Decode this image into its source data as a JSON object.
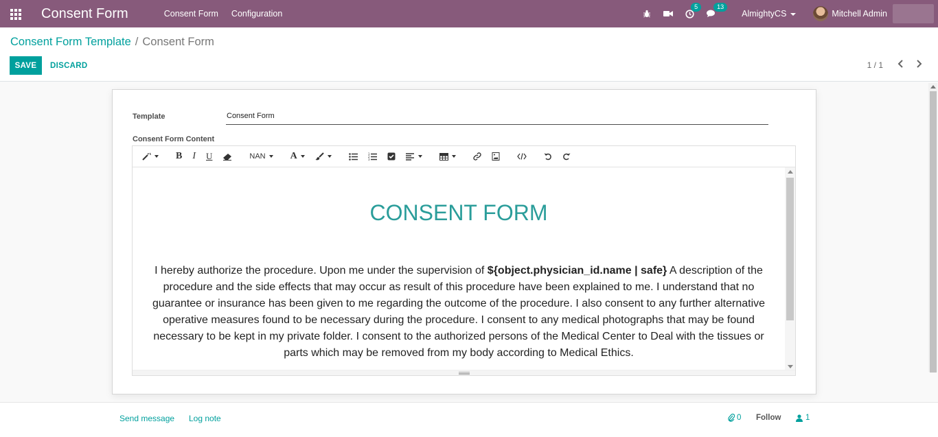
{
  "navbar": {
    "brand": "Consent Form",
    "menu": [
      "Consent Form",
      "Configuration"
    ],
    "activity_count": "5",
    "message_count": "13",
    "company": "AlmightyCS",
    "user_name": "Mitchell Admin",
    "color": "#875a7b"
  },
  "control_panel": {
    "breadcrumb_parent": "Consent Form Template",
    "breadcrumb_sep": "/",
    "breadcrumb_current": "Consent Form",
    "save_label": "SAVE",
    "discard_label": "DISCARD",
    "pager": "1 / 1"
  },
  "form": {
    "template_label": "Template",
    "template_value": "Consent Form",
    "content_label": "Consent Form Content",
    "toolbar": {
      "bold": "B",
      "italic": "I",
      "underline": "U",
      "font_size": "NAN",
      "font_color": "A"
    },
    "content": {
      "title": "CONSENT FORM",
      "text_before": "I hereby authorize the procedure. Upon me under the supervision of ",
      "placeholder": "${object.physician_id.name | safe}",
      "text_after": " A description of the procedure and the side effects that may occur as result of this procedure have been explained to me. I understand that no guarantee or insurance has been given to me regarding the outcome of the procedure. I also consent to any further alternative operative measures found to be necessary during the procedure. I consent to any medical photographs that may be found necessary to be kept in my private folder. I consent to the authorized persons of the Medical Center to Deal with the tissues or parts which may be removed from my body according to Medical Ethics."
    }
  },
  "chatter": {
    "send_message": "Send message",
    "log_note": "Log note",
    "attachments": "0",
    "follow": "Follow",
    "followers": "1"
  },
  "colors": {
    "accent": "#00a09d",
    "title": "#2a9d9a"
  }
}
